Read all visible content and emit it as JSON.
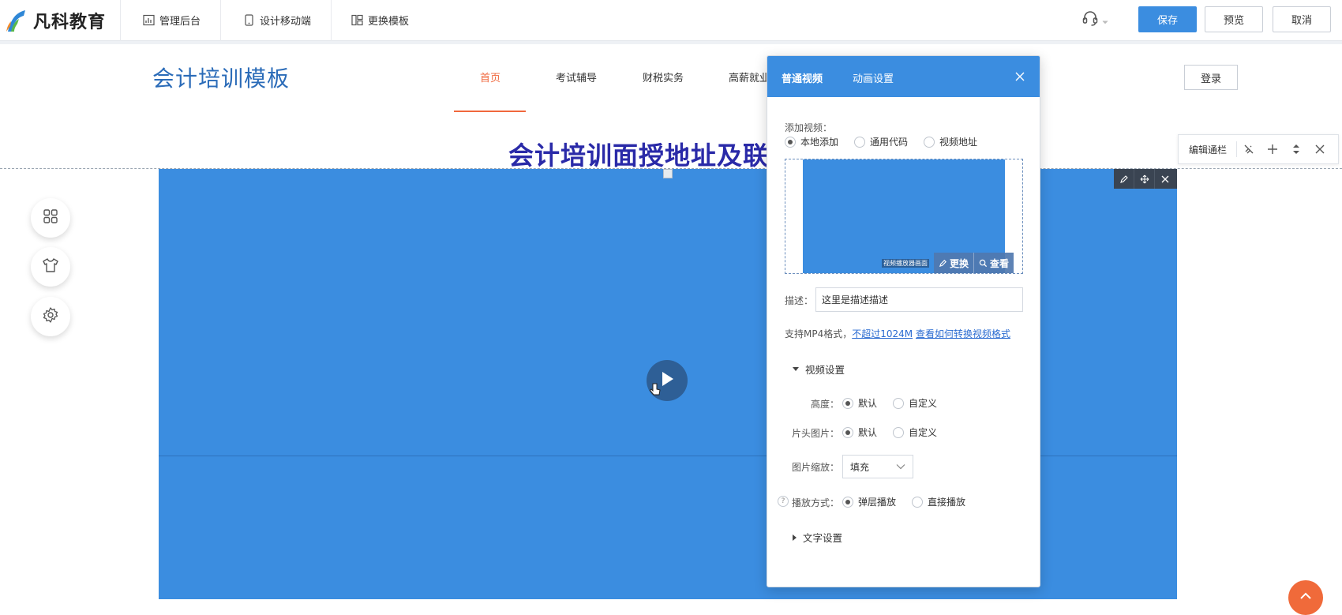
{
  "topbar": {
    "logo_text": "凡科教育",
    "admin_label": "管理后台",
    "mobile_label": "设计移动端",
    "template_label": "更换模板",
    "save_label": "保存",
    "preview_label": "预览",
    "cancel_label": "取消"
  },
  "site": {
    "title": "会计培训模板",
    "nav": [
      "首页",
      "考试辅导",
      "财税实务",
      "高薪就业"
    ],
    "login_label": "登录",
    "section_heading": "会计培训面授地址及联系"
  },
  "edit_bar": {
    "label": "编辑通栏"
  },
  "panel": {
    "tabs": [
      "普通视频",
      "动画设置"
    ],
    "add_video_label": "添加视频：",
    "source_options": [
      "本地添加",
      "通用代码",
      "视频地址"
    ],
    "preview_caption": "视频播放器画面",
    "replace_label": "更换",
    "view_label": "查看",
    "desc_label": "描述：",
    "desc_value": "这里是描述描述",
    "hint_prefix": "支持MP4格式，",
    "hint_link1": "不超过1024M",
    "hint_link2": "查看如何转换视频格式",
    "video_settings_label": "视频设置",
    "height_label": "高度：",
    "height_options": [
      "默认",
      "自定义"
    ],
    "cover_label": "片头图片：",
    "cover_options": [
      "默认",
      "自定义"
    ],
    "scale_label": "图片缩放：",
    "scale_value": "填充",
    "play_mode_label": "播放方式：",
    "play_mode_options": [
      "弹层播放",
      "直接播放"
    ],
    "help_mark": "?",
    "text_settings_label": "文字设置"
  },
  "colors": {
    "accent": "#3b8de0",
    "nav_active": "#f0683d",
    "heading": "#2a2aa8"
  }
}
